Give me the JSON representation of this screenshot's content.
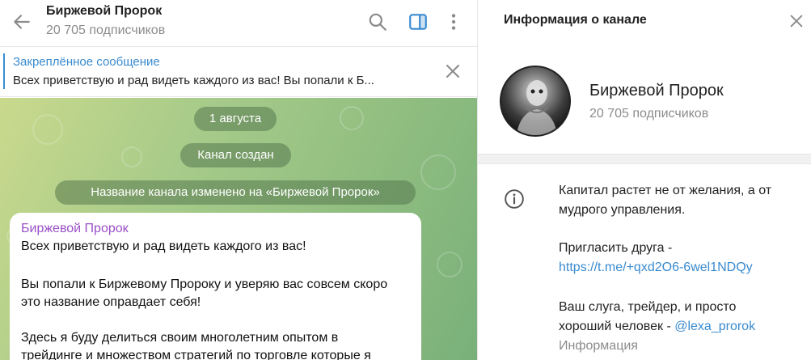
{
  "chat": {
    "title": "Биржевой Пророк",
    "subscribers": "20 705 подписчиков"
  },
  "pinned": {
    "title": "Закреплённое сообщение",
    "text": "Всех приветствую и рад видеть каждого из вас!  Вы попали к Б..."
  },
  "service": {
    "date": "1 августа",
    "created": "Канал создан",
    "renamed": "Название канала изменено на «Биржевой Пророк»"
  },
  "message": {
    "author": "Биржевой Пророк",
    "lines": [
      "Всех приветствую и рад видеть каждого из вас!",
      "Вы попали к Биржевому Пророку и уверяю вас совсем скоро",
      "это название оправдает себя!",
      "Здесь я буду делиться своим многолетним опытом в",
      "трейдинге и множеством стратегий по торговле которые я"
    ]
  },
  "info": {
    "title": "Информация о канале",
    "name": "Биржевой Пророк",
    "subscribers": "20 705 подписчиков",
    "desc1": "Капитал растет не от желания, а от",
    "desc2": "мудрого управления.",
    "invite_label": "Пригласить друга -",
    "invite_link": "https://t.me/+qxd2O6-6wel1NDQy",
    "servant1": "Ваш слуга, трейдер, и просто",
    "servant2": "хороший человек - ",
    "handle": "@lexa_prorok",
    "caption": "Информация"
  },
  "icons": {
    "back": "arrow-left-icon",
    "search": "search-icon",
    "sidebar": "sidebar-toggle-icon",
    "more": "more-vertical-icon",
    "close": "close-icon",
    "info": "info-icon"
  },
  "colors": {
    "accent": "#3a8bcf",
    "author": "#9a4fc6",
    "sidebar_icon": "#3a8bcf",
    "chat_bg": "#a7cb8a"
  }
}
